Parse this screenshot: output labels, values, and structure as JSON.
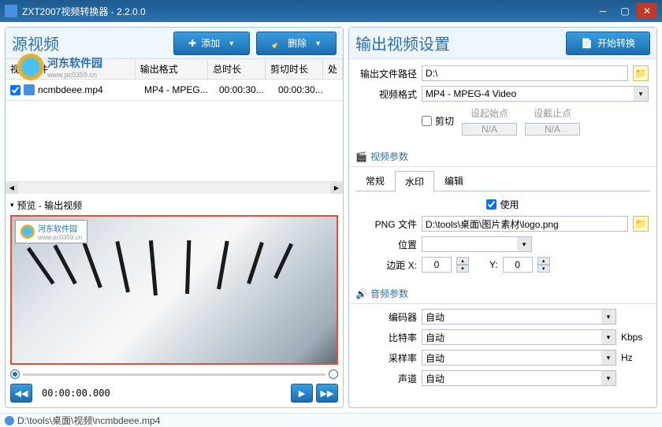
{
  "titlebar": {
    "title": "ZXT2007视频转换器 - 2.2.0.0"
  },
  "watermark": {
    "brand": "河东软件园",
    "url": "www.pc0359.cn"
  },
  "left": {
    "title": "源视频",
    "add_btn": "添加",
    "delete_btn": "删除",
    "table": {
      "col_file": "视频文件",
      "col_fmt": "输出格式",
      "col_dur": "总时长",
      "col_cut": "剪切时长",
      "col_proc": "处",
      "rows": [
        {
          "file": "ncmbdeee.mp4",
          "fmt": "MP4 - MPEG...",
          "dur": "00:00:30...",
          "cut": "00:00:30..."
        }
      ]
    },
    "preview_label": "预览 - 输出视频",
    "preview_subtitle": "",
    "timecode": "00:00:00.000"
  },
  "right": {
    "title": "输出视频设置",
    "convert_btn": "开始转换",
    "output_path_label": "输出文件路径",
    "output_path": "D:\\",
    "video_format_label": "视频格式",
    "video_format": "MP4 - MPEG-4 Video",
    "cut_label": "剪切",
    "cut_start_label": "设起始点",
    "cut_end_label": "设截止点",
    "na": "N/A",
    "video_params": "视频参数",
    "tabs": {
      "general": "常规",
      "watermark": "水印",
      "edit": "编辑"
    },
    "use_label": "使用",
    "png_label": "PNG 文件",
    "png_path": "D:\\tools\\桌面\\图片素材\\logo.png",
    "position_label": "位置",
    "margin_label": "边距 X:",
    "margin_x": "0",
    "margin_y_label": "Y:",
    "margin_y": "0",
    "audio_params": "音频参数",
    "encoder_label": "编码器",
    "bitrate_label": "比特率",
    "samplerate_label": "采样率",
    "channel_label": "声道",
    "auto": "自动",
    "kbps": "Kbps",
    "hz": "Hz"
  },
  "status": {
    "path": "D:\\tools\\桌面\\视频\\ncmbdeee.mp4"
  }
}
